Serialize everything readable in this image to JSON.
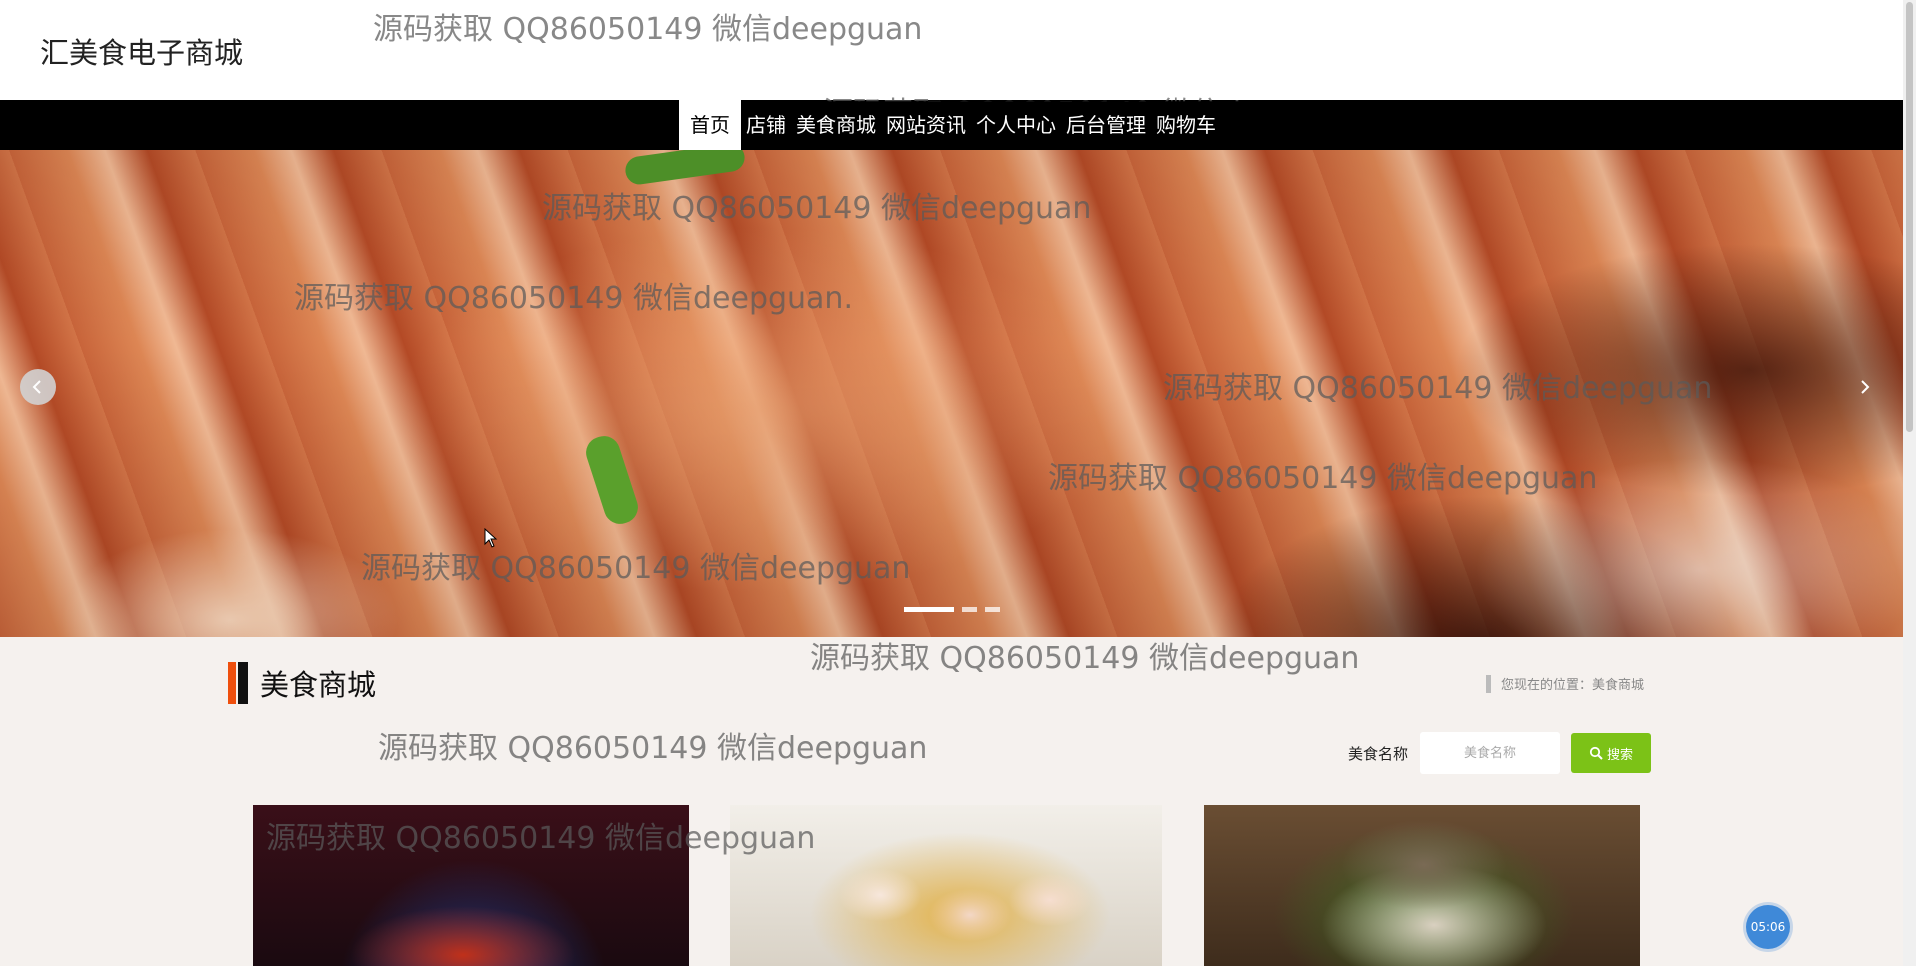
{
  "site": {
    "title": "汇美食电子商城"
  },
  "nav": {
    "items": [
      {
        "label": "首页",
        "active": true
      },
      {
        "label": "店铺"
      },
      {
        "label": "美食商城"
      },
      {
        "label": "网站资讯"
      },
      {
        "label": "个人中心"
      },
      {
        "label": "后台管理"
      },
      {
        "label": "购物车"
      }
    ]
  },
  "carousel": {
    "slides": 3,
    "active_index": 0,
    "prev_icon": "chevron-left-icon",
    "next_icon": "chevron-right-icon"
  },
  "section": {
    "title": "美食商城",
    "accent_color": "#ef4f0d"
  },
  "breadcrumb": {
    "text": "您现在的位置：美食商城"
  },
  "search": {
    "label": "美食名称",
    "placeholder": "美食名称",
    "button_label": "搜索",
    "button_color": "#7cc217",
    "icon": "search-icon"
  },
  "products": [
    {
      "name": "product-card-1"
    },
    {
      "name": "product-card-2"
    },
    {
      "name": "product-card-3"
    }
  ],
  "timer": {
    "text": "05:06"
  },
  "watermarks": [
    "源码获取 QQ86050149 微信deepguan",
    "源码获取 QQ86050149 微信d",
    "源码获取 QQ86050149 微信deepguan",
    "源码获取 QQ86050149 微信deepguan.",
    "源码获取 QQ86050149 微信deepguan",
    "源码获取 QQ86050149 微信deepguan",
    "源码获取 QQ86050149 微信deepguan",
    "源码获取 QQ86050149 微信deepguan",
    "源码获取 QQ86050149 微信deepguan",
    "源码获取 QQ86050149 微信deepguan"
  ]
}
